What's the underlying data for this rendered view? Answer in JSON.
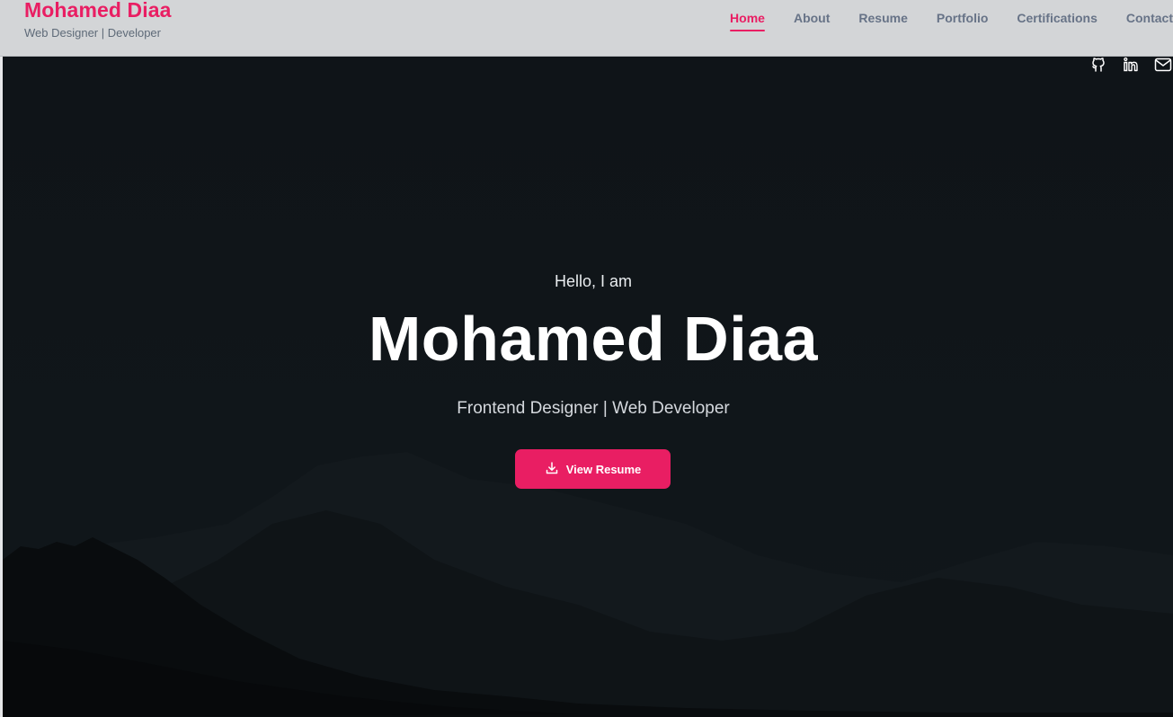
{
  "header": {
    "brand_name": "Mohamed Diaa",
    "tagline": "Web Designer | Developer",
    "nav": [
      {
        "label": "Home",
        "active": true
      },
      {
        "label": "About",
        "active": false
      },
      {
        "label": "Resume",
        "active": false
      },
      {
        "label": "Portfolio",
        "active": false
      },
      {
        "label": "Certifications",
        "active": false
      },
      {
        "label": "Contact",
        "active": false
      }
    ]
  },
  "social": [
    {
      "icon": "github-icon"
    },
    {
      "icon": "linkedin-icon"
    },
    {
      "icon": "mail-icon"
    }
  ],
  "hero": {
    "greeting": "Hello, I am",
    "name": "Mohamed Diaa",
    "role": "Frontend Designer | Web Developer",
    "cta_label": "View Resume",
    "cta_icon": "download-icon"
  },
  "colors": {
    "accent": "#e91e63",
    "header_bg": "#d3d5d7",
    "nav_text": "#677387",
    "hero_bg": "#0f1418"
  }
}
